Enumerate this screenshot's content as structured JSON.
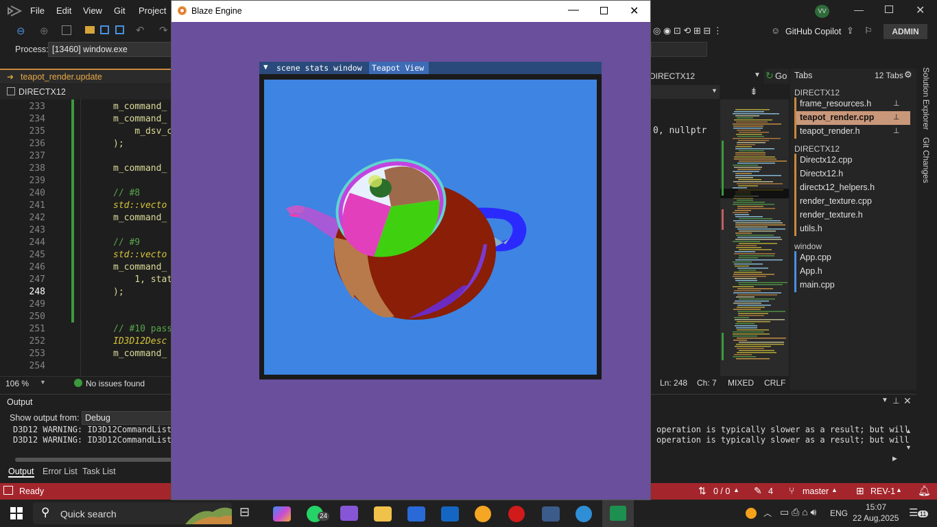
{
  "vs": {
    "menu": [
      "File",
      "Edit",
      "View",
      "Git",
      "Project"
    ],
    "user_initials": "VV",
    "copilot_label": "GitHub Copilot",
    "admin_label": "ADMIN",
    "process_label": "Process:",
    "process_value": "[13460] window.exe",
    "active_tab": "teapot_render.update",
    "nav_project": "DIRECTX12",
    "right_nav": "DIRECTX12",
    "go_label": "Go",
    "line_numbers": [
      "233",
      "234",
      "235",
      "236",
      "237",
      "238",
      "239",
      "240",
      "241",
      "242",
      "243",
      "244",
      "245",
      "246",
      "247",
      "248",
      "249",
      "250",
      "251",
      "252",
      "253",
      "254"
    ],
    "code_lines": [
      "m_command_",
      "m_command_",
      "    m_dsv_c",
      ");",
      "",
      "m_command_",
      "",
      "// #8",
      "std::vecto",
      "m_command_",
      "",
      "// #9",
      "std::vecto",
      "m_command_",
      "    1, stat",
      ");",
      "",
      "",
      "// #10 pass",
      "ID3D12Desc",
      "m_command_",
      ""
    ],
    "code_right": "0, nullptr",
    "zoom": "106 %",
    "issues": "No issues found",
    "cursor_line": "Ln: 248",
    "cursor_col": "Ch: 7",
    "encoding": "MIXED",
    "line_ending": "CRLF"
  },
  "tabs_panel": {
    "title": "Tabs",
    "count": "12 Tabs",
    "groups": [
      {
        "name": "DIRECTX12",
        "items": [
          "frame_resources.h",
          "teapot_render.cpp",
          "teapot_render.h"
        ]
      },
      {
        "name": "DIRECTX12",
        "items": [
          "Directx12.cpp",
          "Directx12.h",
          "directx12_helpers.h",
          "render_texture.cpp",
          "render_texture.h",
          "utils.h"
        ]
      },
      {
        "name": "window",
        "items": [
          "App.cpp",
          "App.h",
          "main.cpp"
        ]
      }
    ],
    "side_tabs": [
      "Solution Explorer",
      "Git Changes"
    ]
  },
  "output": {
    "title": "Output",
    "show_from_label": "Show output from:",
    "source": "Debug",
    "lines_left": [
      "D3D12 WARNING: ID3D12CommandList:",
      "D3D12 WARNING: ID3D12CommandList:"
    ],
    "lines_right": [
      "operation is typically slower as a result; but will",
      "operation is typically slower as a result; but will"
    ],
    "tabs": [
      "Output",
      "Error List",
      "Task List"
    ]
  },
  "status": {
    "ready": "Ready",
    "git_counts": "0 / 0",
    "pencil_count": "4",
    "branch": "master",
    "repo": "REV-1"
  },
  "taskbar": {
    "search": "Quick search",
    "whatsapp_badge": "24",
    "lang": "ENG",
    "time": "15:07",
    "date": "22 Aug,2025",
    "notif_count": "11"
  },
  "blaze": {
    "title": "Blaze Engine",
    "imgui_tabs": [
      "scene stats window",
      "Teapot View"
    ],
    "colors": {
      "bg": "#6a4f9c",
      "viewport": "#3d84e3"
    }
  }
}
